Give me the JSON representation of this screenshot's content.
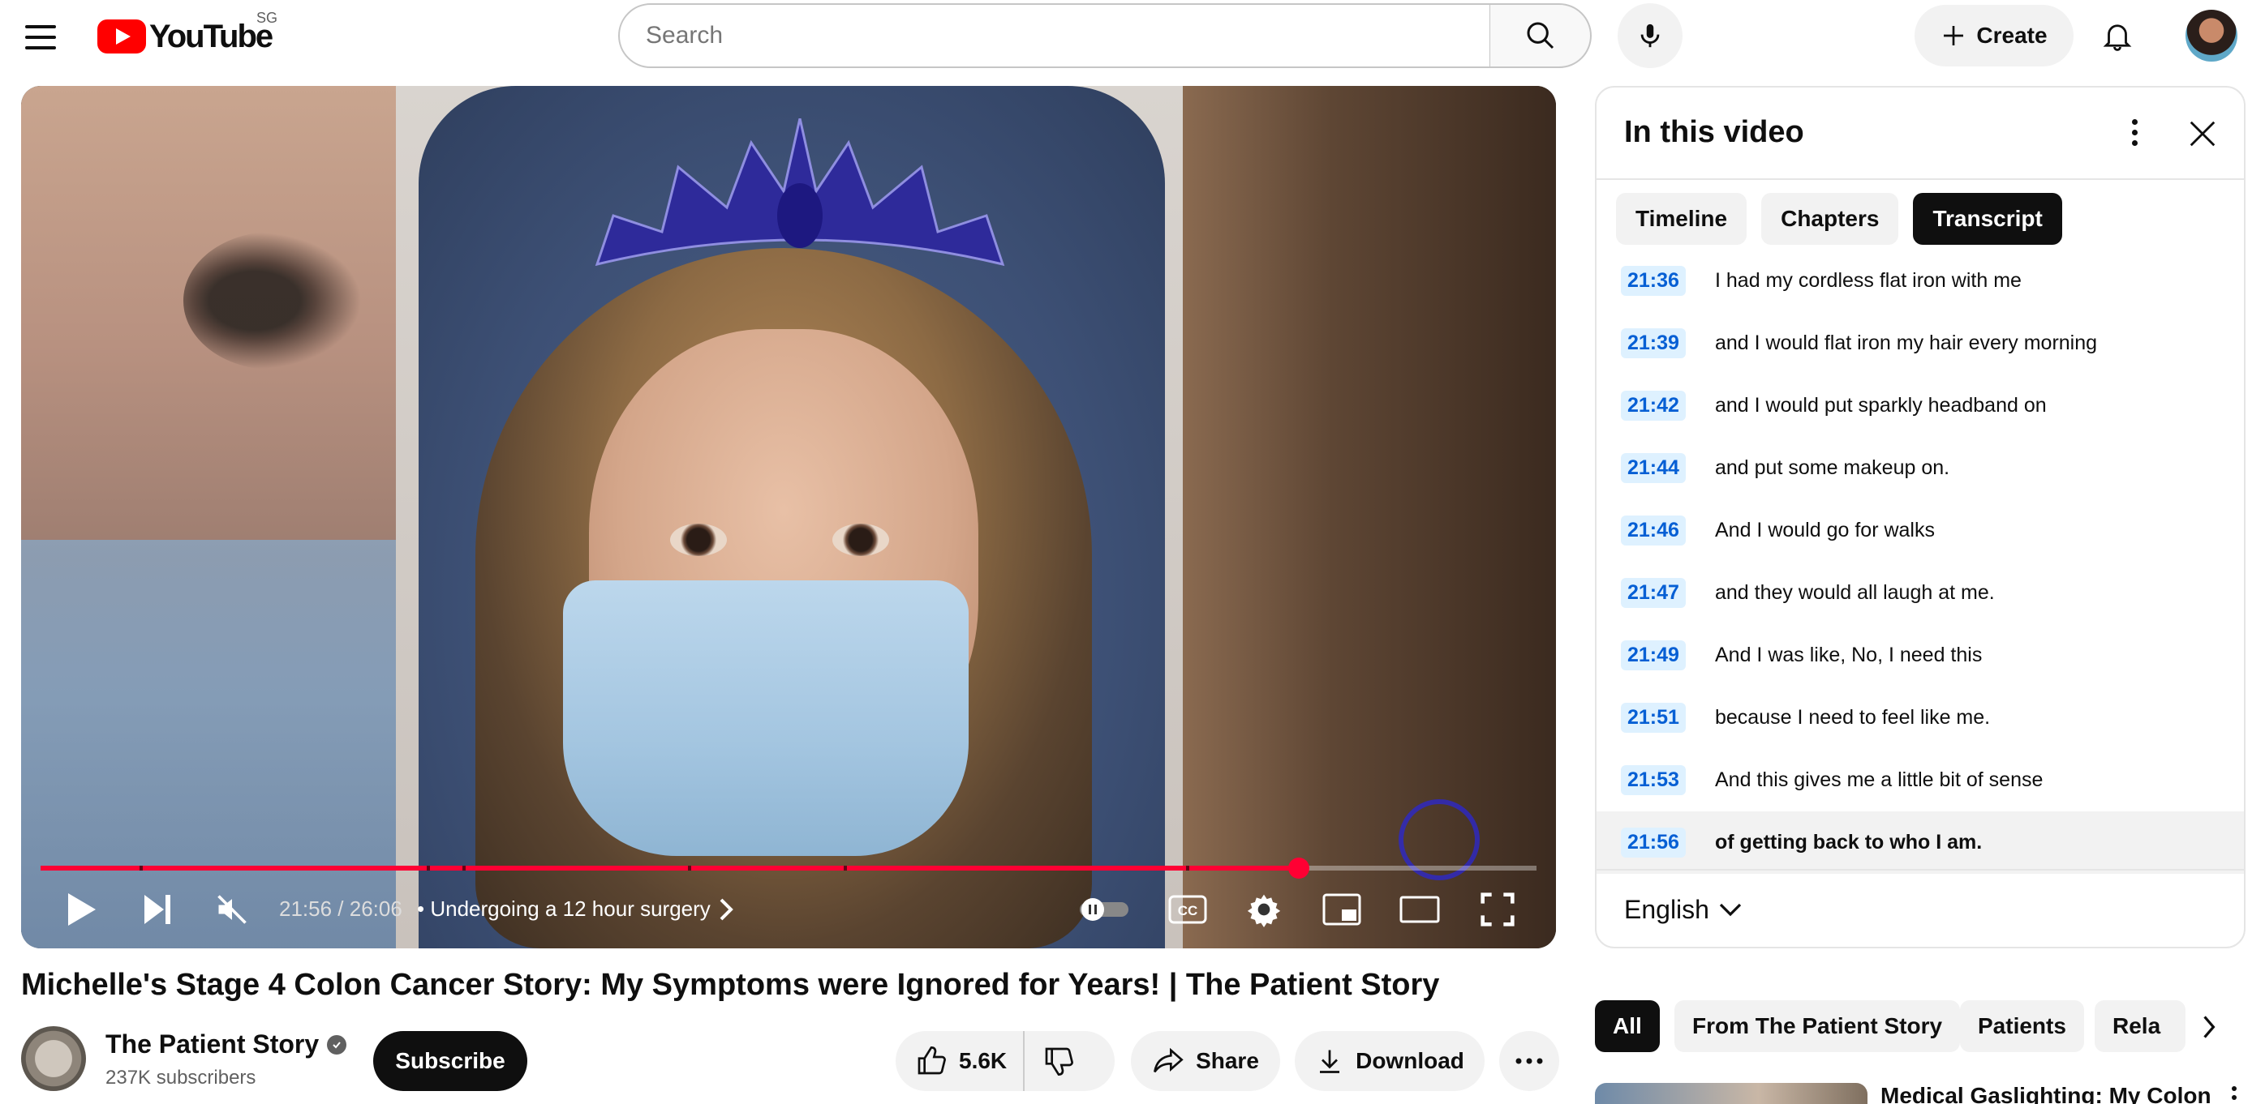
{
  "masthead": {
    "logo_text": "YouTube",
    "country_code": "SG",
    "search_placeholder": "Search",
    "create_label": "Create",
    "icons": [
      "menu-icon",
      "search-icon",
      "mic-icon",
      "plus-icon",
      "bell-icon"
    ]
  },
  "player": {
    "time_display": "21:56 / 26:06",
    "chapter_title": "• Undergoing a 12 hour surgery",
    "progress_fraction": 0.841,
    "muted": true,
    "accent_color": "#ff0033"
  },
  "video": {
    "title": "Michelle's Stage 4 Colon Cancer Story: My Symptoms were Ignored for Years! | The Patient Story",
    "channel_name": "The Patient Story",
    "subscribers": "237K subscribers",
    "subscribe_label": "Subscribe",
    "like_count": "5.6K",
    "share_label": "Share",
    "download_label": "Download"
  },
  "panel": {
    "title": "In this video",
    "tabs": [
      {
        "label": "Timeline",
        "active": false
      },
      {
        "label": "Chapters",
        "active": false
      },
      {
        "label": "Transcript",
        "active": true
      }
    ],
    "segments": [
      {
        "time": "21:36",
        "text": "I had my cordless flat iron with me"
      },
      {
        "time": "21:39",
        "text": "and I would flat iron my hair every morning"
      },
      {
        "time": "21:42",
        "text": "and I would put sparkly headband on"
      },
      {
        "time": "21:44",
        "text": "and put some makeup on."
      },
      {
        "time": "21:46",
        "text": "And I would go for walks"
      },
      {
        "time": "21:47",
        "text": "and they would all laugh at me."
      },
      {
        "time": "21:49",
        "text": "And I was like, No, I need this"
      },
      {
        "time": "21:51",
        "text": "because I need to feel like me."
      },
      {
        "time": "21:53",
        "text": "And this gives me a little bit of sense"
      },
      {
        "time": "21:56",
        "text": "of getting back to who I am."
      }
    ],
    "language": "English"
  },
  "chips": [
    "All",
    "From The Patient Story",
    "Patients",
    "Rela"
  ],
  "recommendation": {
    "title": "Medical Gaslighting: My Colon"
  }
}
